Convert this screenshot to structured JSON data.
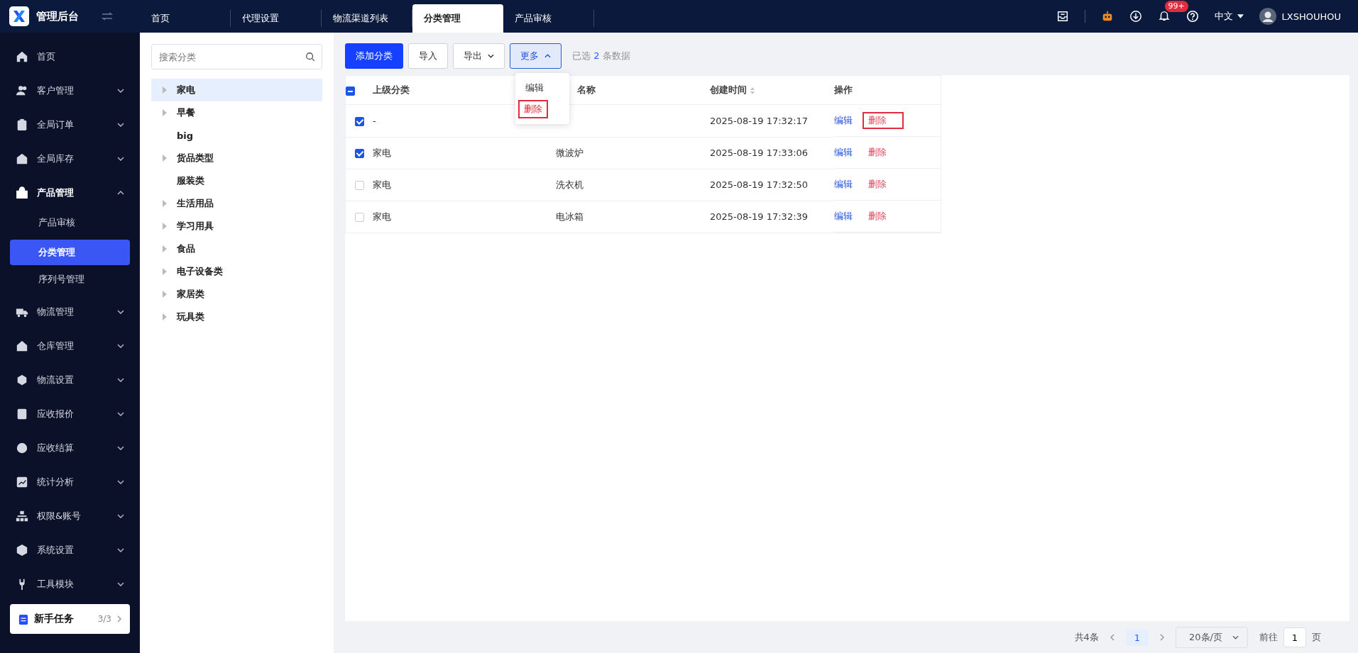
{
  "app": {
    "title": "管理后台"
  },
  "tabs": [
    {
      "label": "首页",
      "selected": false
    },
    {
      "label": "代理设置",
      "selected": false
    },
    {
      "label": "物流渠道列表",
      "selected": false
    },
    {
      "label": "分类管理",
      "selected": true
    },
    {
      "label": "产品审核",
      "selected": false
    }
  ],
  "header": {
    "notification_badge": "99+",
    "language": "中文",
    "user": "LXSHOUHOU"
  },
  "sidebar": {
    "items": [
      {
        "label": "首页",
        "expanded": false,
        "has_children": false
      },
      {
        "label": "客户管理",
        "expanded": false,
        "has_children": true
      },
      {
        "label": "全局订单",
        "expanded": false,
        "has_children": true
      },
      {
        "label": "全局库存",
        "expanded": false,
        "has_children": true
      },
      {
        "label": "产品管理",
        "expanded": true,
        "has_children": true,
        "children": [
          {
            "label": "产品审核",
            "selected": false
          },
          {
            "label": "分类管理",
            "selected": true
          },
          {
            "label": "序列号管理",
            "selected": false
          }
        ]
      },
      {
        "label": "物流管理",
        "expanded": false,
        "has_children": true
      },
      {
        "label": "仓库管理",
        "expanded": false,
        "has_children": true
      },
      {
        "label": "物流设置",
        "expanded": false,
        "has_children": true
      },
      {
        "label": "应收报价",
        "expanded": false,
        "has_children": true
      },
      {
        "label": "应收结算",
        "expanded": false,
        "has_children": true
      },
      {
        "label": "统计分析",
        "expanded": false,
        "has_children": true
      },
      {
        "label": "权限&账号",
        "expanded": false,
        "has_children": true
      },
      {
        "label": "系统设置",
        "expanded": false,
        "has_children": true
      },
      {
        "label": "工具模块",
        "expanded": false,
        "has_children": true
      }
    ],
    "task_card": {
      "label": "新手任务",
      "progress": "3/3",
      "completed": true
    }
  },
  "tree": {
    "search": {
      "placeholder": "搜索分类"
    },
    "items": [
      {
        "label": "家电",
        "has_children": true,
        "selected": true
      },
      {
        "label": "早餐",
        "has_children": true,
        "selected": false
      },
      {
        "label": "big",
        "has_children": false,
        "selected": false
      },
      {
        "label": "货品类型",
        "has_children": true,
        "selected": false
      },
      {
        "label": "服装类",
        "has_children": false,
        "selected": false
      },
      {
        "label": "生活用品",
        "has_children": true,
        "selected": false
      },
      {
        "label": "学习用具",
        "has_children": true,
        "selected": false
      },
      {
        "label": "食品",
        "has_children": true,
        "selected": false
      },
      {
        "label": "电子设备类",
        "has_children": true,
        "selected": false
      },
      {
        "label": "家居类",
        "has_children": true,
        "selected": false
      },
      {
        "label": "玩具类",
        "has_children": true,
        "selected": false
      }
    ]
  },
  "toolbar": {
    "buttons": [
      {
        "label": "添加分类",
        "kind": "primary",
        "expanded": false
      },
      {
        "label": "导入",
        "kind": "plain",
        "expanded": false
      },
      {
        "label": "导出",
        "kind": "dropdown",
        "expanded": false
      },
      {
        "label": "更多",
        "kind": "dropdown",
        "expanded": true
      }
    ],
    "selection_prefix": "已选",
    "selection_count": "2",
    "selection_suffix": "条数据"
  },
  "more_menu": {
    "items": [
      {
        "label": "编辑",
        "kind": "normal",
        "highlighted": false
      },
      {
        "label": "删除",
        "kind": "danger",
        "highlighted": true
      }
    ]
  },
  "table": {
    "header_checkbox": {
      "indeterminate": true
    },
    "columns": [
      "上级分类",
      "名称",
      "创建时间",
      "操作"
    ],
    "rows": [
      {
        "checked": true,
        "parent": "-",
        "created": "2025-08-19 17:32:17",
        "edit": "编辑",
        "delete": "删除",
        "delete_highlighted": true
      },
      {
        "checked": true,
        "parent": "家电",
        "name": "微波炉",
        "created": "2025-08-19 17:33:06",
        "edit": "编辑",
        "delete": "删除",
        "delete_highlighted": false
      },
      {
        "checked": false,
        "parent": "家电",
        "name": "洗衣机",
        "created": "2025-08-19 17:32:50",
        "edit": "编辑",
        "delete": "删除",
        "delete_highlighted": false
      },
      {
        "checked": false,
        "parent": "家电",
        "name": "电冰箱",
        "created": "2025-08-19 17:32:39",
        "edit": "编辑",
        "delete": "删除",
        "delete_highlighted": false
      }
    ]
  },
  "pagination": {
    "total": "共4条",
    "pages": [
      {
        "label": "1",
        "selected": true
      }
    ],
    "page_size": "20条/页",
    "goto_label": "前往",
    "goto_value": "1",
    "goto_suffix": "页"
  }
}
